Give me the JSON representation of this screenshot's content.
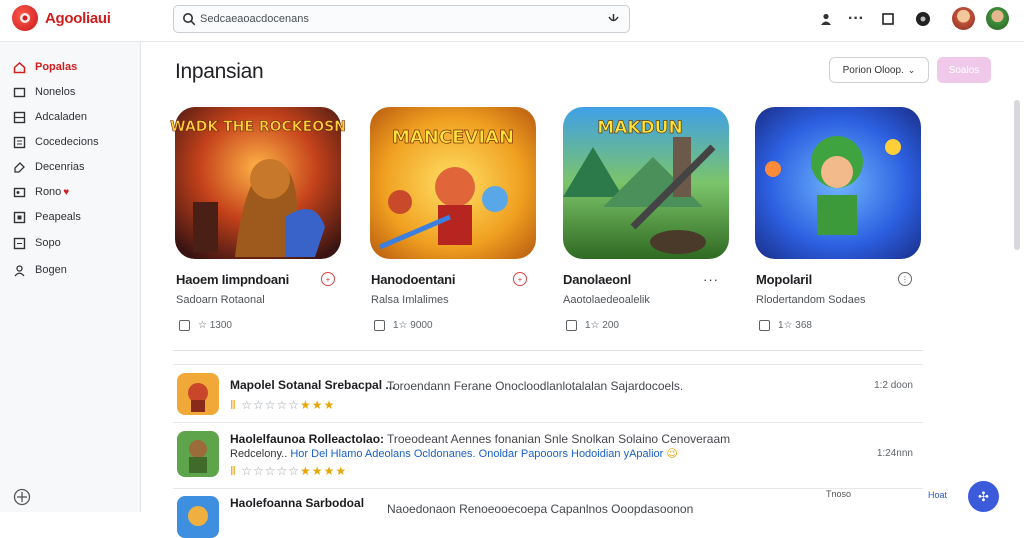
{
  "app": {
    "title": "Agooliaui",
    "logo_icon": "game-logo-icon",
    "brand_color": "#d01e1e"
  },
  "search": {
    "placeholder": "Sedcaeaoacdocenans",
    "mic_icon": "mic-icon"
  },
  "toolbar": {
    "icons": [
      "people-icon",
      "more-dots-icon",
      "square-icon",
      "record-icon",
      "avatar-1",
      "avatar-2"
    ]
  },
  "sidebar": {
    "items": [
      {
        "label": "Popalas",
        "icon": "home-icon",
        "active": true
      },
      {
        "label": "Nonelos",
        "icon": "box-icon"
      },
      {
        "label": "Adcaladen",
        "icon": "grid-icon"
      },
      {
        "label": "Cocedecions",
        "icon": "list-icon"
      },
      {
        "label": "Decenrias",
        "icon": "tag-icon"
      },
      {
        "label": "Rono",
        "icon": "tag2-icon"
      },
      {
        "label": "Peapeals",
        "icon": "square-icon"
      },
      {
        "label": "Sopo",
        "icon": "list2-icon"
      },
      {
        "label": "Bogen",
        "icon": "user-icon"
      }
    ],
    "bottom_icon": "settings-icon"
  },
  "main": {
    "title": "Inpansian",
    "sort_label": "Porion Oloop.",
    "action_label": "Soalos"
  },
  "cards": [
    {
      "art_title": "WADK THE ROCKEOSN",
      "title": "Haoem Iimpndoani",
      "subtitle": "Sadoarn Rotaonal",
      "meta": "☆ 1300",
      "action": "+"
    },
    {
      "art_title": "MANCEVIAN",
      "title": "Hanodoentani",
      "subtitle": "Ralsa Imlalimes",
      "meta": "1☆ 9000",
      "action": "+"
    },
    {
      "art_title": "MAKDUN",
      "title": "Danolaeonl",
      "subtitle": "Aaotolaedeoalelik",
      "meta": "1☆ 200",
      "action": "···"
    },
    {
      "art_title": "",
      "title": "Mopolaril",
      "subtitle": "Rlodertandom Sodaes",
      "meta": "1☆ 368",
      "action": "⋮"
    }
  ],
  "rows": [
    {
      "title": "Mapolel Sotanal Srebacpal ...",
      "desc": "Toroendann Ferane Onocloodlanlotalalan Sajardocoels.",
      "time": "1:2 doon",
      "stars_on": 3,
      "stars_off": 5
    },
    {
      "title": "Haolelfaunoa Rolleactolao:",
      "desc": "Troeodeant Aennes fonanian Snle Snolkan Solaino Cenoveraam",
      "link_prefix": "Redcelony..",
      "link": "Hor Del Hlamo Adeolans Ocldonanes.  Onoldar Papooors Hodoidian yApalior",
      "time": "1:24nnn",
      "stars_on": 4,
      "stars_off": 5
    },
    {
      "title": "Haolefoanna Sarbodoal",
      "desc": "Naoedonaon Renoeooecoepa Capanlnos Ooopdasoonon",
      "time": ""
    }
  ],
  "snackbar": {
    "text": "Tnoso",
    "action": "Hoat"
  },
  "fab_icon": "add-icon"
}
